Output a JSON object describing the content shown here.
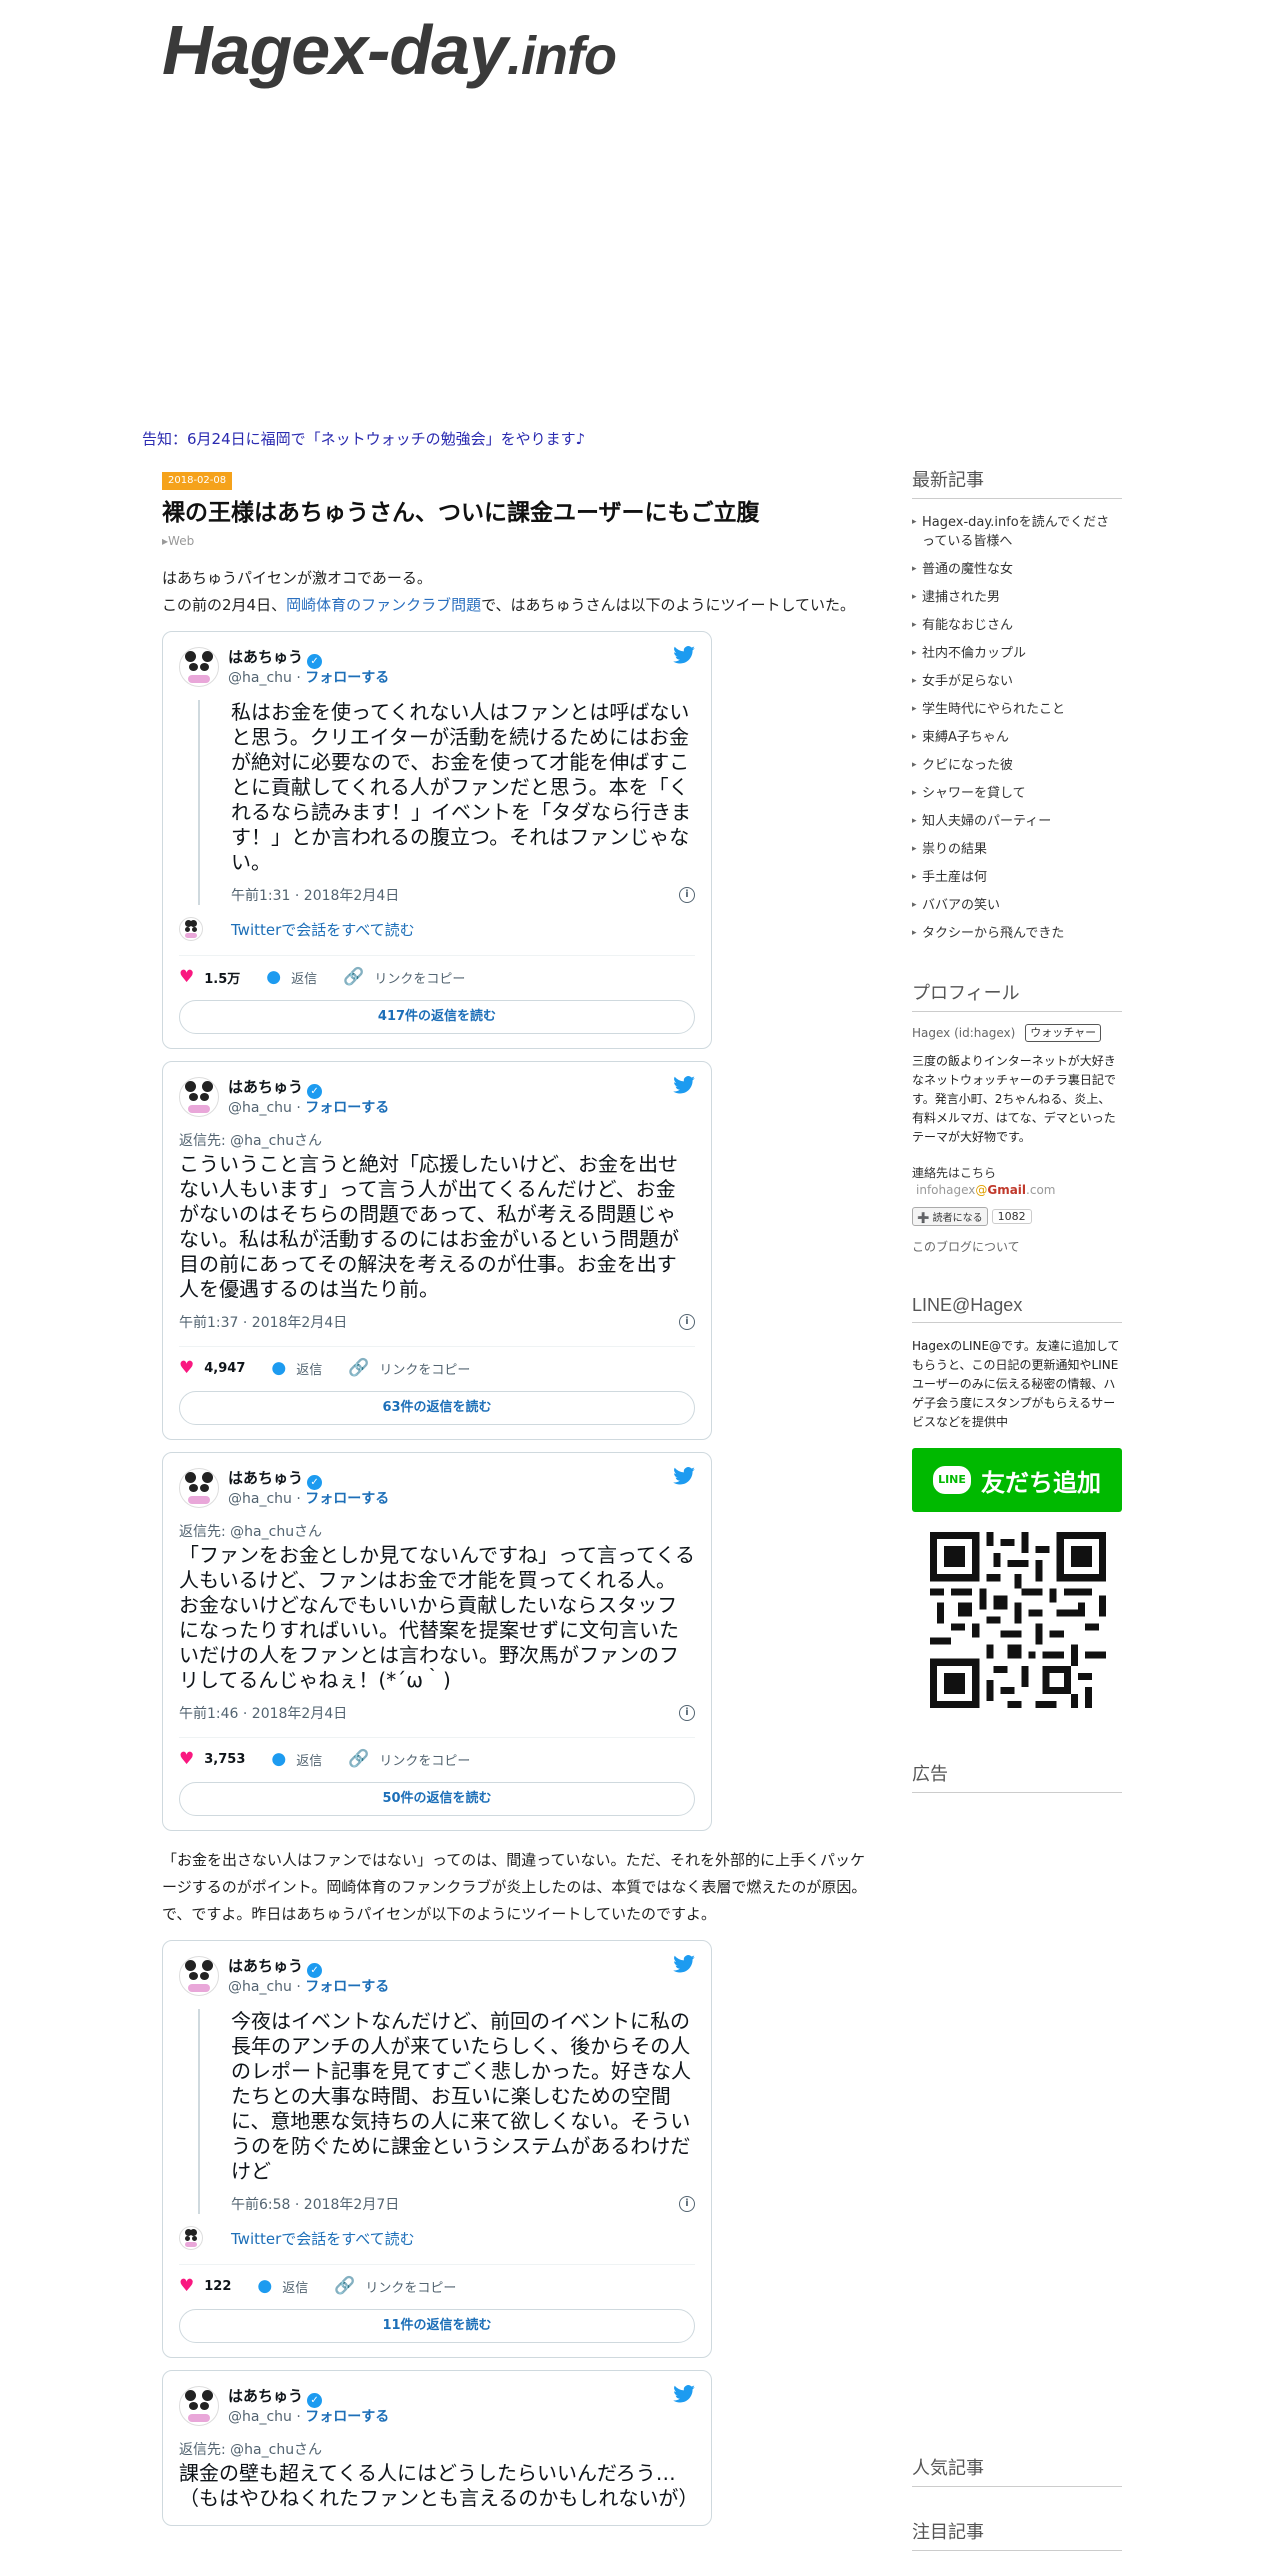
{
  "header": {
    "title_main": "Hagex-day",
    "title_tld": ".info",
    "notice": "告知：6月24日に福岡で「ネットウォッチの勉強会」をやります♪"
  },
  "article": {
    "date": "2018-02-08",
    "title": "裸の王様はあちゅうさん、ついに課金ユーザーにもご立腹",
    "category": "Web",
    "intro": {
      "line1": "はあちゅうパイセンが激オコであーる。",
      "line2_before": "この前の2月4日、",
      "line2_link": "岡崎体育のファンクラブ問題",
      "line2_after": "で、はあちゅうさんは以下のようにツイートしていた。"
    },
    "middle": {
      "line1": "「お金を出さない人はファンではない」ってのは、間違っていない。ただ、それを外部的に上手くパッケージするのがポイント。岡崎体育のファンクラブが炎上したのは、本質ではなく表層で燃えたのが原因。",
      "line2": "で、ですよ。昨日はあちゅうパイセンが以下のようにツイートしていたのですよ。"
    }
  },
  "tweets": [
    {
      "name": "はあちゅう",
      "handle": "@ha_chu · ",
      "follow": "フォローする",
      "text": "私はお金を使ってくれない人はファンとは呼ばないと思う。クリエイターが活動を続けるためにはお金が絶対に必要なので、お金を使って才能を伸ばすことに貢献してくれる人がファンだと思う。本を「くれるなら読みます！」イベントを「タダなら行きます！」とか言われるの腹立つ。それはファンじゃない。",
      "time": "午前1:31 · 2018年2月4日",
      "convo": "Twitterで会話をすべて読む",
      "likes": "1.5万",
      "reply": "返信",
      "copy": "リンクをコピー",
      "read": "417件の返信を読む"
    },
    {
      "name": "はあちゅう",
      "handle": "@ha_chu · ",
      "follow": "フォローする",
      "reply_to": "返信先: @ha_chuさん",
      "text": "こういうこと言うと絶対「応援したいけど、お金を出せない人もいます」って言う人が出てくるんだけど、お金がないのはそちらの問題であって、私が考える問題じゃない。私は私が活動するのにはお金がいるという問題が目の前にあってその解決を考えるのが仕事。お金を出す人を優遇するのは当たり前。",
      "time": "午前1:37 · 2018年2月4日",
      "likes": "4,947",
      "reply": "返信",
      "copy": "リンクをコピー",
      "read": "63件の返信を読む"
    },
    {
      "name": "はあちゅう",
      "handle": "@ha_chu · ",
      "follow": "フォローする",
      "reply_to": "返信先: @ha_chuさん",
      "text": "「ファンをお金としか見てないんですね」って言ってくる人もいるけど、ファンはお金で才能を買ってくれる人。お金ないけどなんでもいいから貢献したいならスタッフになったりすればいい。代替案を提案せずに文句言いたいだけの人をファンとは言わない。野次馬がファンのフリしてるんじゃねぇ！(*´ω｀)",
      "time": "午前1:46 · 2018年2月4日",
      "likes": "3,753",
      "reply": "返信",
      "copy": "リンクをコピー",
      "read": "50件の返信を読む"
    },
    {
      "name": "はあちゅう",
      "handle": "@ha_chu · ",
      "follow": "フォローする",
      "text": "今夜はイベントなんだけど、前回のイベントに私の長年のアンチの人が来ていたらしく、後からその人のレポート記事を見てすごく悲しかった。好きな人たちとの大事な時間、お互いに楽しむための空間に、意地悪な気持ちの人に来て欲しくない。そういうのを防ぐために課金というシステムがあるわけだけど",
      "time": "午前6:58 · 2018年2月7日",
      "convo": "Twitterで会話をすべて読む",
      "likes": "122",
      "reply": "返信",
      "copy": "リンクをコピー",
      "read": "11件の返信を読む"
    },
    {
      "name": "はあちゅう",
      "handle": "@ha_chu · ",
      "follow": "フォローする",
      "reply_to": "返信先: @ha_chuさん",
      "text": "課金の壁も超えてくる人にはどうしたらいいんだろう…（もはやひねくれたファンとも言えるのかもしれないが）"
    }
  ],
  "sidebar": {
    "recent_heading": "最新記事",
    "recent_items": [
      "Hagex-day.infoを読んでくださっている皆様へ",
      "普通の魔性な女",
      "逮捕された男",
      "有能なおじさん",
      "社内不倫カップル",
      "女手が足らない",
      "学生時代にやられたこと",
      "束縛A子ちゃん",
      "クビになった彼",
      "シャワーを貸して",
      "知人夫婦のパーティー",
      "祟りの結果",
      "手土産は何",
      "ババアの笑い",
      "タクシーから飛んできた"
    ],
    "profile_heading": "プロフィール",
    "profile_name": "Hagex (id:hagex)",
    "profile_badge": "ウォッチャー",
    "profile_text": "三度の飯よりインターネットが大好きなネットウォッチャーのチラ裏日記です。発言小町、2ちゃんねる、炎上、有料メルマガ、はてな、デマといったテーマが大好物です。",
    "contact_label": "連絡先はこちら",
    "email_prefix": "infohagex",
    "email_at": "@",
    "email_gmail": "Gmail",
    "email_suffix": ".com",
    "readers_label": "➕ 読者になる",
    "readers_count": "1082",
    "about_link": "このブログについて",
    "line_heading": "LINE@Hagex",
    "line_text": "HagexのLINE@です。友達に追加してもらうと、この日記の更新通知やLINEユーザーのみに伝える秘密の情報、ハゲ子会う度にスタンプがもらえるサービスなどを提供中",
    "line_logo": "LINE",
    "line_button": "友だち追加",
    "ad_heading": "広告",
    "popular_heading": "人気記事",
    "featured_heading": "注目記事"
  },
  "colors": {
    "twitter_blue": "#1d9bf0",
    "line_green": "#00b900",
    "date_badge": "#f5a21b",
    "like_pink": "#f91880"
  },
  "icons": [
    "twitter-bird-icon",
    "verified-icon",
    "heart-icon",
    "reply-icon",
    "link-icon",
    "info-icon",
    "line-logo-icon",
    "qr-code"
  ]
}
